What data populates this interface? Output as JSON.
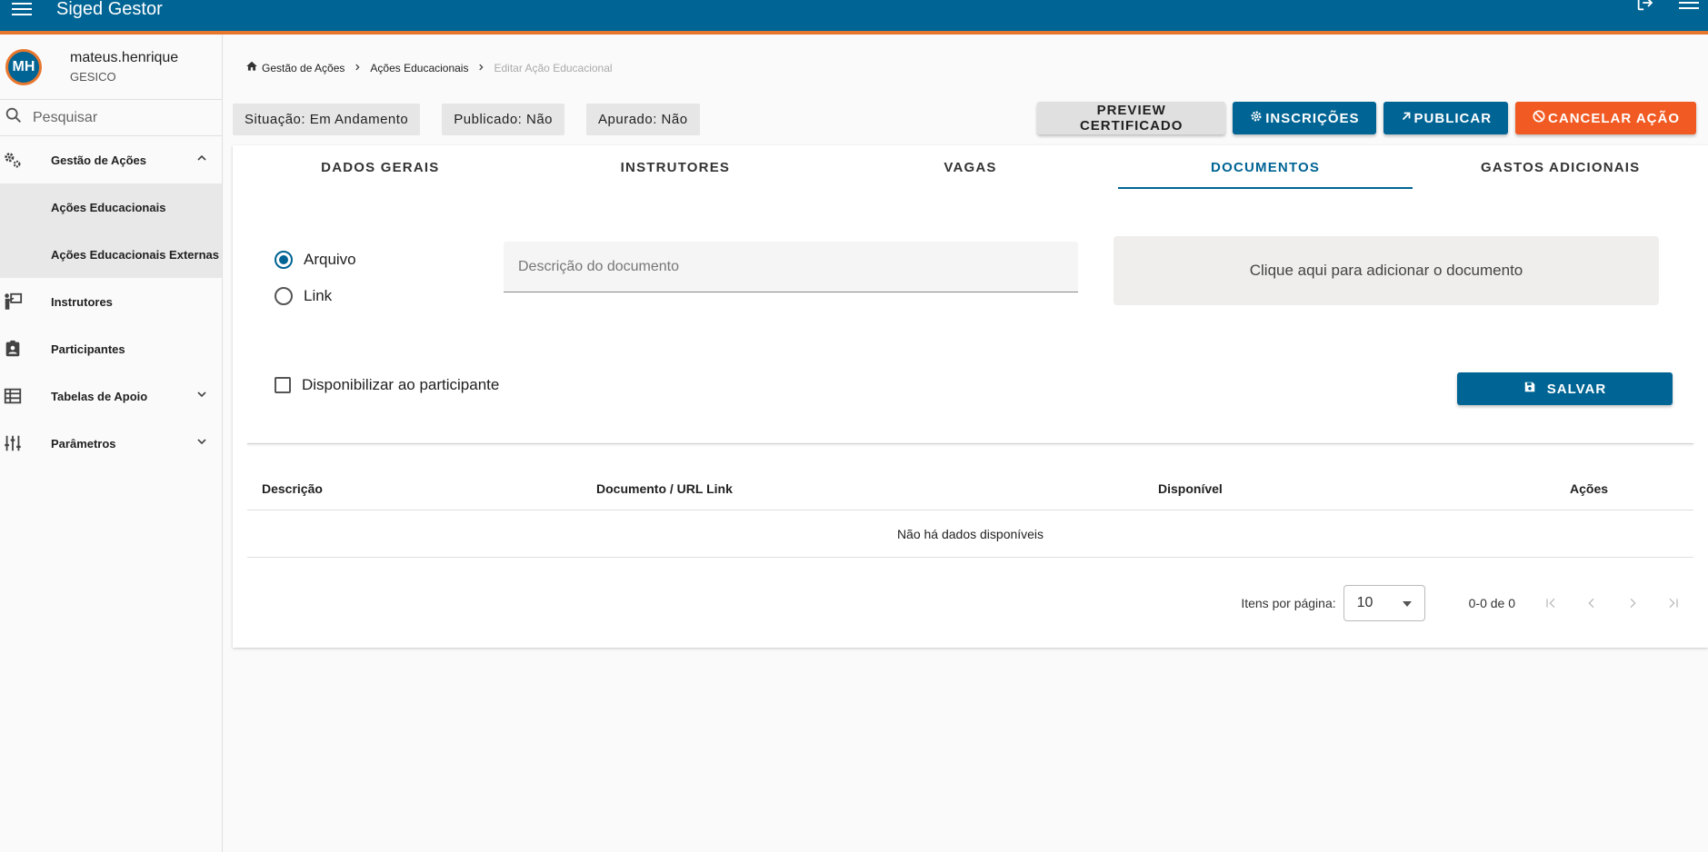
{
  "header": {
    "title": "Siged Gestor"
  },
  "user": {
    "initials": "MH",
    "name": "mateus.henrique",
    "org": "GESICO"
  },
  "search": {
    "placeholder": "Pesquisar"
  },
  "sidebar": {
    "items": [
      {
        "label": "Gestão de Ações"
      },
      {
        "label": "Ações Educacionais"
      },
      {
        "label": "Ações Educacionais Externas"
      },
      {
        "label": "Instrutores"
      },
      {
        "label": "Participantes"
      },
      {
        "label": "Tabelas de Apoio"
      },
      {
        "label": "Parâmetros"
      }
    ]
  },
  "breadcrumb": {
    "home": "Gestão de Ações",
    "section": "Ações Educacionais",
    "current": "Editar Ação Educacional"
  },
  "status": {
    "situacao": "Situação: Em Andamento",
    "publicado": "Publicado: Não",
    "apurado": "Apurado: Não"
  },
  "actions": {
    "preview": "PREVIEW CERTIFICADO",
    "inscricoes": "INSCRIÇÕES",
    "publicar": "PUBLICAR",
    "cancelar": "CANCELAR AÇÃO"
  },
  "tabs": [
    {
      "label": "DADOS GERAIS"
    },
    {
      "label": "INSTRUTORES"
    },
    {
      "label": "VAGAS"
    },
    {
      "label": "DOCUMENTOS"
    },
    {
      "label": "GASTOS ADICIONAIS"
    }
  ],
  "form": {
    "radio_file": "Arquivo",
    "radio_link": "Link",
    "desc_placeholder": "Descrição do documento",
    "dropzone": "Clique aqui para adicionar o documento",
    "checkbox": "Disponibilizar ao participante",
    "save": "SALVAR"
  },
  "table": {
    "columns": [
      "Descrição",
      "Documento / URL Link",
      "Disponível",
      "Ações"
    ],
    "empty": "Não há dados disponíveis"
  },
  "paginator": {
    "label": "Itens por página:",
    "page_size": "10",
    "range": "0-0 de 0"
  },
  "colors": {
    "primary": "#006494",
    "accent": "#e8772e",
    "danger": "#f15a22"
  }
}
